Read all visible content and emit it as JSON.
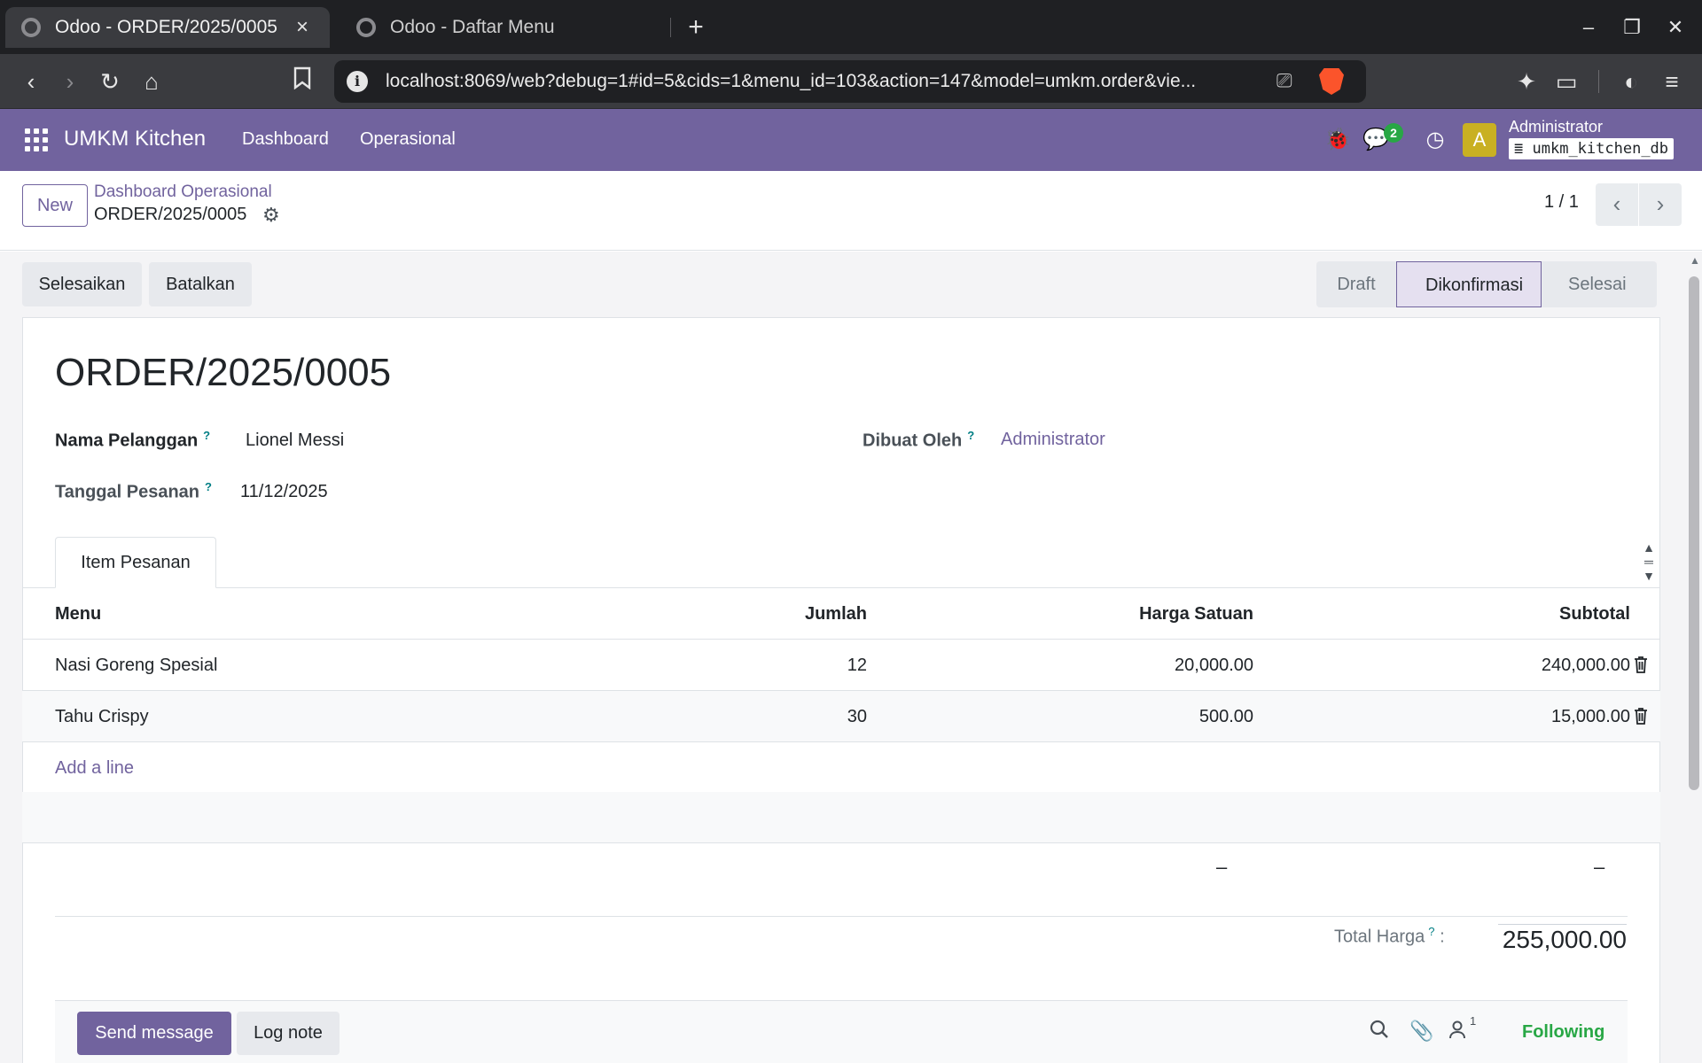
{
  "browser": {
    "tabs": [
      {
        "title": "Odoo - ORDER/2025/0005",
        "active": true
      },
      {
        "title": "Odoo - Daftar Menu",
        "active": false
      }
    ],
    "url": "localhost:8069/web?debug=1#id=5&cids=1&menu_id=103&action=147&model=umkm.order&vie..."
  },
  "odoo": {
    "app_name": "UMKM Kitchen",
    "menus": [
      "Dashboard",
      "Operasional"
    ],
    "messages_count": "2",
    "avatar_letter": "A",
    "user": "Administrator",
    "database": "umkm_kitchen_db"
  },
  "control": {
    "new_label": "New",
    "breadcrumb_parent": "Dashboard Operasional",
    "breadcrumb_current": "ORDER/2025/0005",
    "pager": "1 / 1"
  },
  "actions": {
    "finish": "Selesaikan",
    "cancel": "Batalkan"
  },
  "status": {
    "stages": [
      "Draft",
      "Dikonfirmasi",
      "Selesai"
    ],
    "current": "Dikonfirmasi"
  },
  "record": {
    "title": "ORDER/2025/0005",
    "customer_label": "Nama Pelanggan",
    "customer": "Lionel Messi",
    "date_label": "Tanggal Pesanan",
    "date": "11/12/2025",
    "created_by_label": "Dibuat Oleh",
    "created_by": "Administrator",
    "help_mark": "?"
  },
  "notebook": {
    "tab": "Item Pesanan"
  },
  "lines": {
    "headers": {
      "menu": "Menu",
      "qty": "Jumlah",
      "price": "Harga Satuan",
      "subtotal": "Subtotal"
    },
    "rows": [
      {
        "menu": "Nasi Goreng Spesial",
        "qty": "12",
        "price": "20,000.00",
        "subtotal": "240,000.00"
      },
      {
        "menu": "Tahu Crispy",
        "qty": "30",
        "price": "500.00",
        "subtotal": "15,000.00"
      }
    ],
    "add_line": "Add a line",
    "footer_price": "–",
    "footer_subtotal": "–"
  },
  "totals": {
    "label": "Total Harga",
    "colon": ":",
    "value": "255,000.00"
  },
  "chatter": {
    "send_message": "Send message",
    "log_note": "Log note",
    "followers_count": "1",
    "following": "Following"
  }
}
